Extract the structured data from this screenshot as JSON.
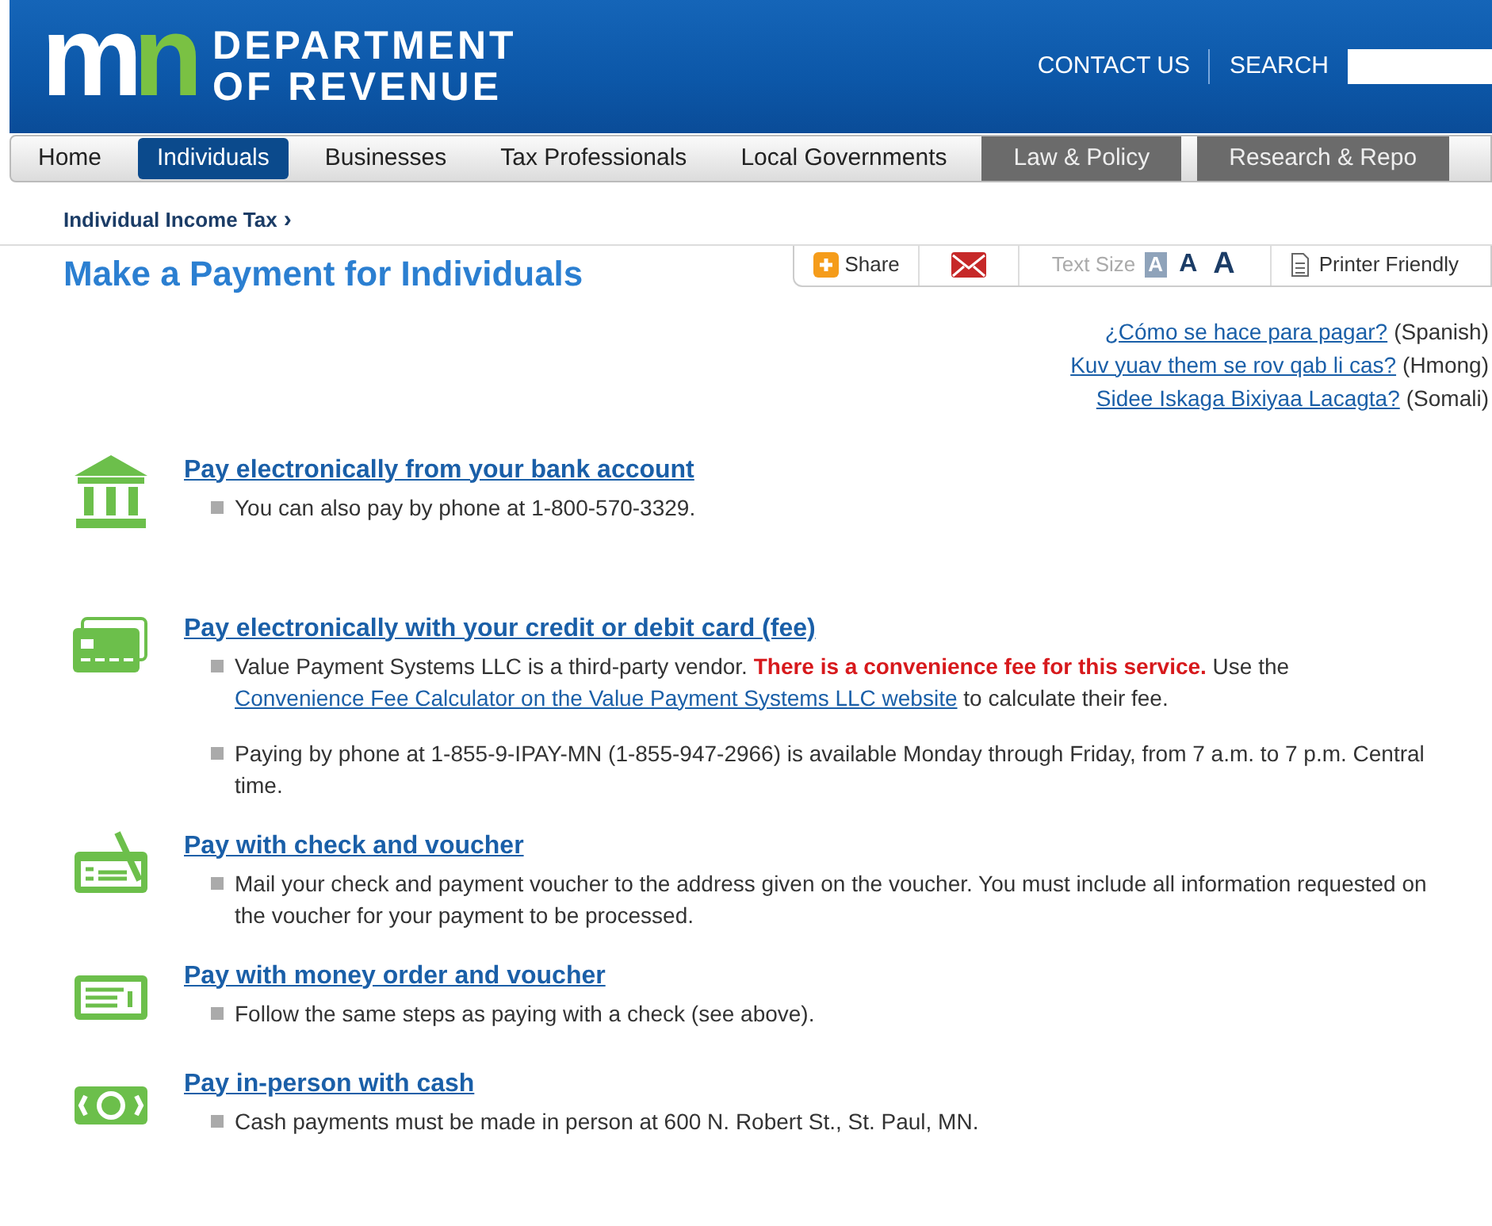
{
  "header": {
    "logo_mark": "mn",
    "logo_line_1": "DEPARTMENT",
    "logo_line_2": "OF REVENUE",
    "contact": "CONTACT US",
    "search_label": "SEARCH"
  },
  "nav": [
    {
      "label": "Home",
      "kind": "main",
      "selected": false
    },
    {
      "label": "Individuals",
      "kind": "main",
      "selected": true
    },
    {
      "label": "Businesses",
      "kind": "main",
      "selected": false
    },
    {
      "label": "Tax Professionals",
      "kind": "main",
      "selected": false
    },
    {
      "label": "Local Governments",
      "kind": "main",
      "selected": false
    },
    {
      "label": "Law & Policy",
      "kind": "secondary",
      "selected": false
    },
    {
      "label": "Research & Repo",
      "kind": "secondary",
      "selected": false
    }
  ],
  "breadcrumb": "Individual Income Tax",
  "breadcrumb_arrow": "›",
  "page_title": "Make a Payment for Individuals",
  "toolbar": {
    "share": "Share",
    "text_size_label": "Text Size",
    "text_sizes": [
      {
        "label": "A",
        "selected": true
      },
      {
        "label": "A",
        "selected": false
      },
      {
        "label": "A",
        "selected": false
      }
    ],
    "printer": "Printer Friendly"
  },
  "languages": [
    {
      "link": "¿Cómo se hace para pagar?",
      "language": "(Spanish)"
    },
    {
      "link": "Kuv yuav them se rov qab li cas?",
      "language": "(Hmong)"
    },
    {
      "link": "Sidee Iskaga Bixiyaa Lacagta?",
      "language": "(Somali)"
    }
  ],
  "sections": [
    {
      "kind": "bank",
      "title": "Pay electronically from your bank account",
      "bullets": [
        [
          {
            "kind": "text",
            "text": "You can also pay by phone at 1-800-570-3329."
          }
        ]
      ]
    },
    {
      "kind": "card",
      "title": "Pay electronically with your credit or debit card (fee)",
      "bullets": [
        [
          {
            "kind": "text",
            "text": "Value Payment Systems LLC is a third-party vendor. **There is a convenience fee for this service.** Use the "
          },
          {
            "kind": "link",
            "text": "Convenience Fee Calculator on the Value Payment Systems LLC website"
          },
          {
            "kind": "text",
            "text": " to calculate their fee."
          }
        ],
        [
          {
            "kind": "text",
            "text": "Paying by phone at 1-855-9-IPAY-MN (1-855-947-2966) is available Monday through Friday, from 7 a.m. to 7 p.m. Central time."
          }
        ]
      ]
    },
    {
      "kind": "check",
      "title": "Pay with check and voucher",
      "bullets": [
        [
          {
            "kind": "text",
            "text": "Mail your check and payment voucher to the address given on the voucher. You must include all information requested on the voucher for your payment to be processed."
          }
        ]
      ]
    },
    {
      "kind": "money_order",
      "title": "Pay with money order and voucher",
      "bullets": [
        [
          {
            "kind": "text",
            "text": "Follow the same steps as paying with a check (see above)."
          }
        ]
      ]
    },
    {
      "kind": "cash",
      "title": "Pay in-person with cash",
      "bullets": [
        [
          {
            "kind": "text",
            "text": "Cash payments must be made in person at 600 N. Robert St., St. Paul, MN."
          }
        ]
      ]
    }
  ]
}
